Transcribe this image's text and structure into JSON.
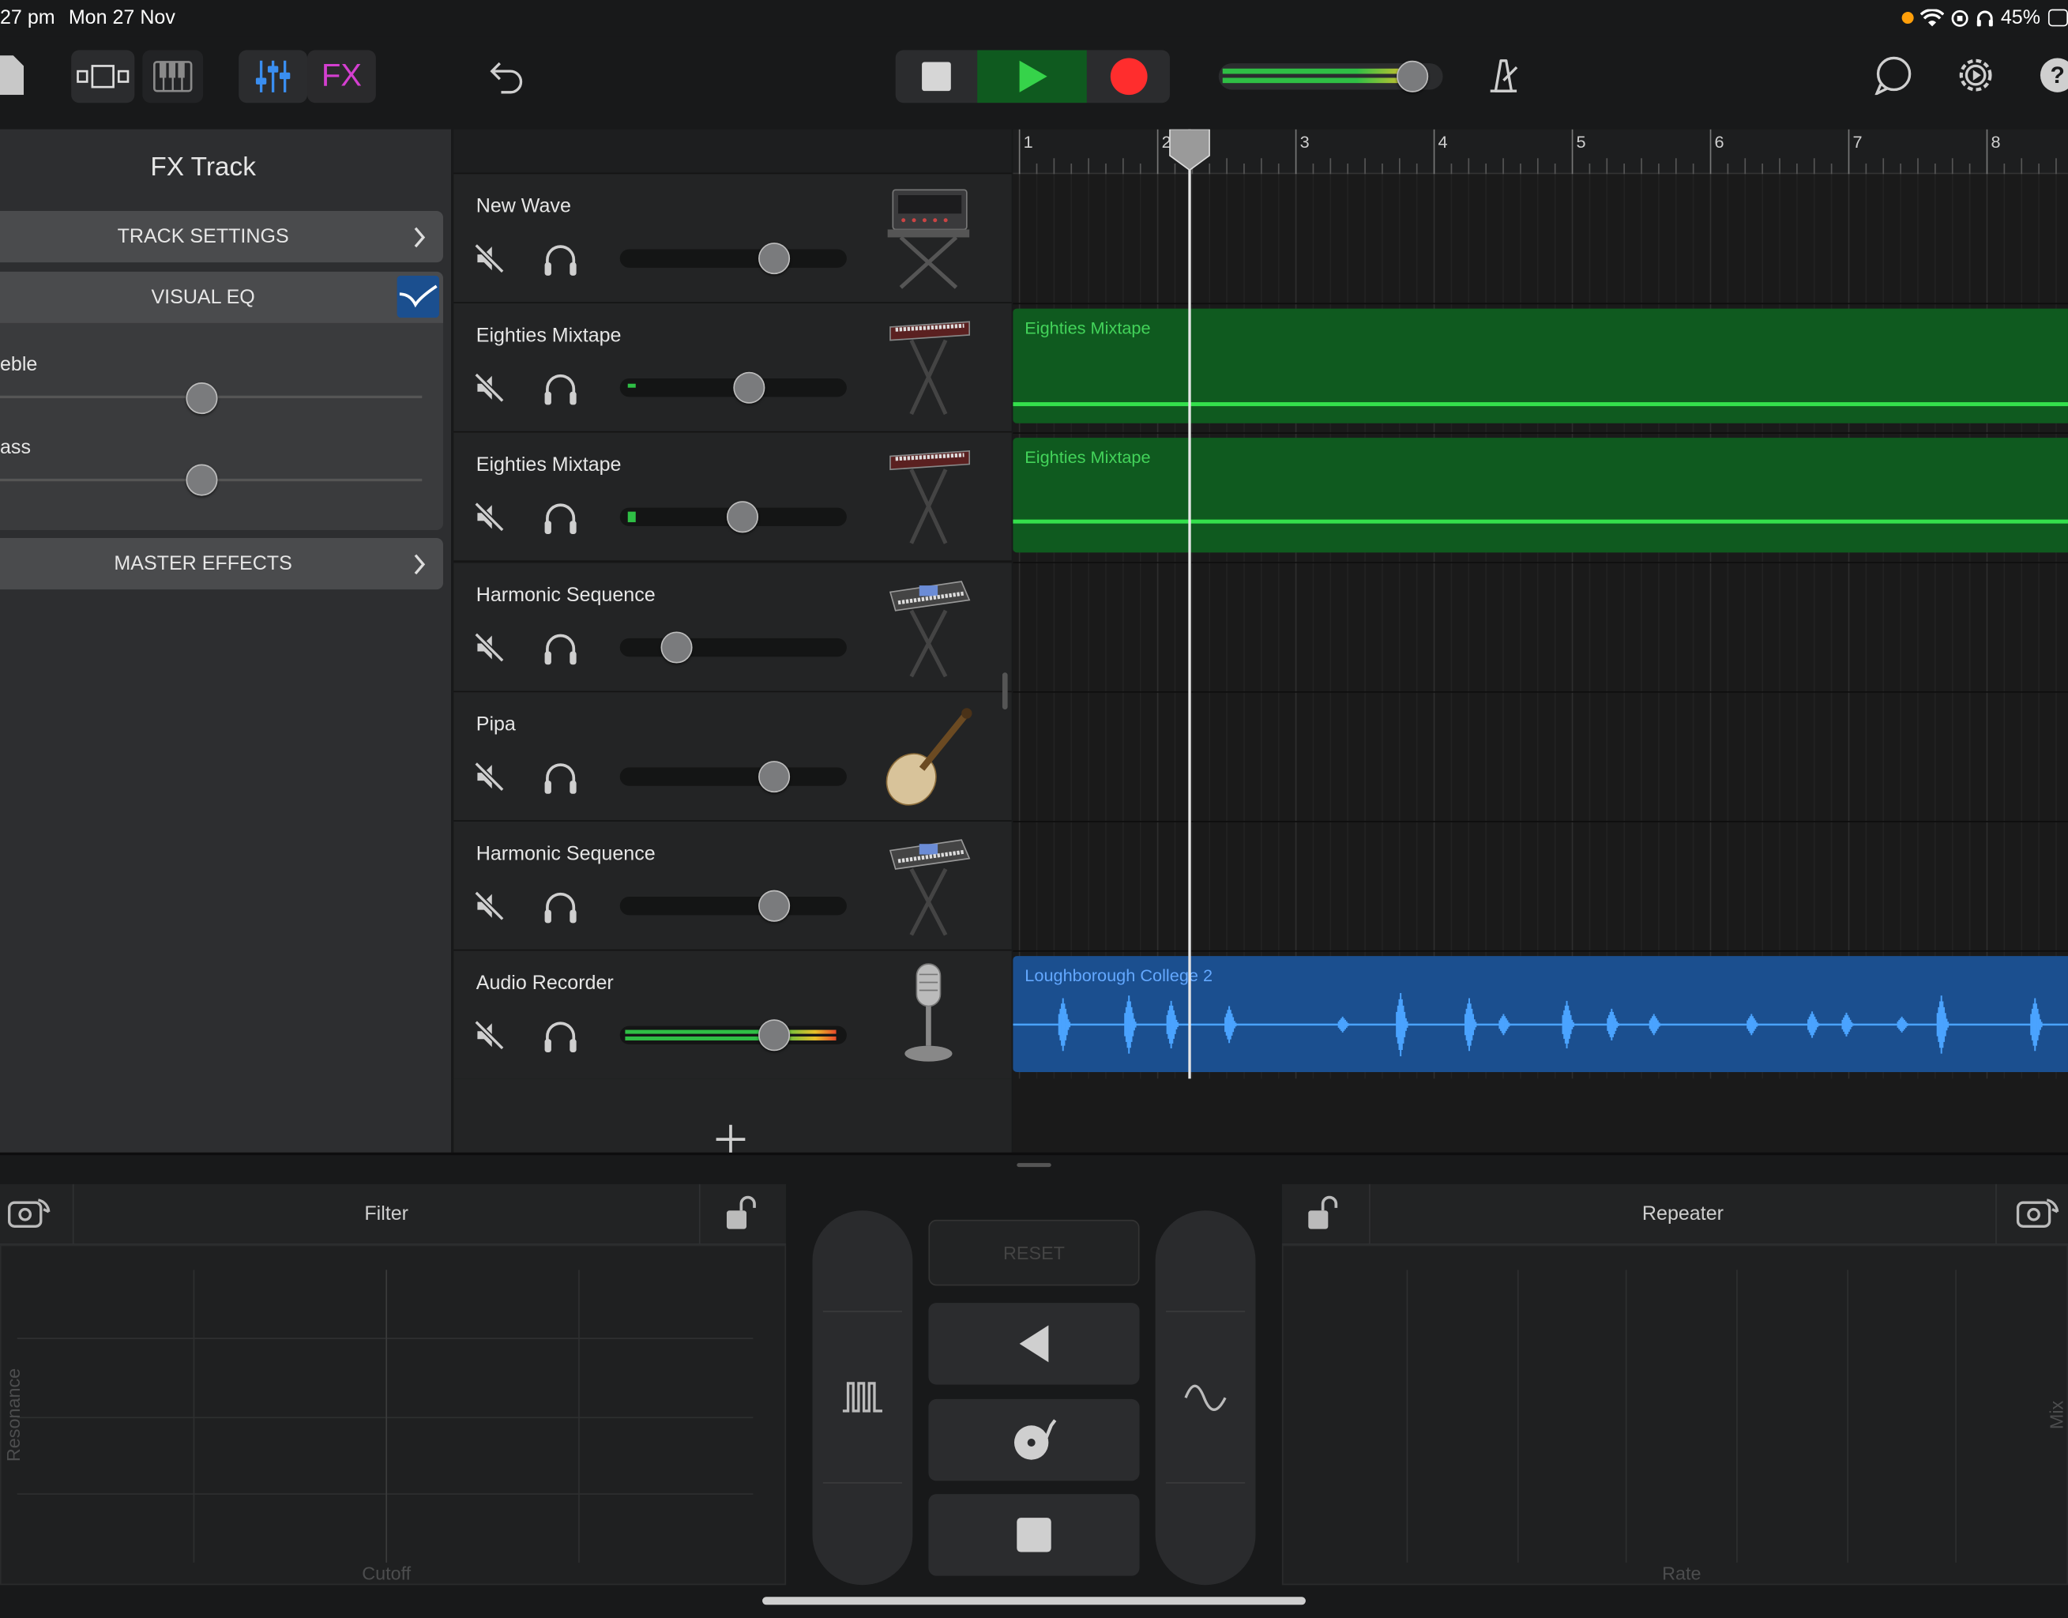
{
  "status_bar": {
    "time": "27 pm",
    "date": "Mon 27 Nov",
    "battery": "45%"
  },
  "toolbar": {
    "fx_label": "FX"
  },
  "fx_panel": {
    "title": "FX Track",
    "track_settings": "TRACK SETTINGS",
    "visual_eq": "VISUAL EQ",
    "treble_label": "eble",
    "bass_label": "ass",
    "master_effects": "MASTER EFFECTS"
  },
  "tracks": [
    {
      "name": "New Wave",
      "volume": 0.68,
      "icon": "synth-rack-icon"
    },
    {
      "name": "Eighties Mixtape",
      "volume": 0.57,
      "icon": "keyboard-stand-icon"
    },
    {
      "name": "Eighties Mixtape",
      "volume": 0.54,
      "icon": "keyboard-stand-icon"
    },
    {
      "name": "Harmonic Sequence",
      "volume": 0.25,
      "icon": "synth-stand-icon"
    },
    {
      "name": "Pipa",
      "volume": 0.68,
      "icon": "pipa-icon"
    },
    {
      "name": "Harmonic Sequence",
      "volume": 0.68,
      "icon": "synth-stand-icon"
    },
    {
      "name": "Audio Recorder",
      "volume": 0.68,
      "icon": "microphone-icon"
    }
  ],
  "ruler": {
    "bars": [
      "1",
      "2",
      "3",
      "4",
      "5",
      "6",
      "7",
      "8"
    ]
  },
  "regions": {
    "r1": "Eighties Mixtape",
    "r2": "Eighties Mixtape",
    "r3": "Loughborough College 2"
  },
  "bottom": {
    "filter_title": "Filter",
    "filter_xlabel": "Cutoff",
    "filter_ylabel": "Resonance",
    "reset_label": "RESET",
    "repeater_title": "Repeater",
    "repeater_xlabel": "Rate",
    "repeater_ylabel": "Mix"
  },
  "colors": {
    "green_region": "#0f5a1f",
    "blue_region": "#1b4f8f",
    "record": "#ff2d2d",
    "play": "#36d34a",
    "fx": "#d43fd0",
    "mixer": "#3a8ef0"
  }
}
